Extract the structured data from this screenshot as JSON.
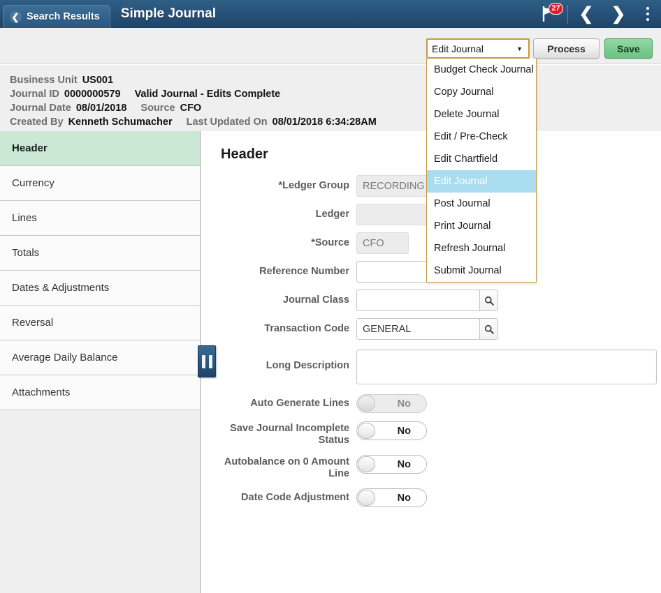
{
  "topbar": {
    "back_label": "Search Results",
    "back_icon": "chevron-left-icon",
    "title": "Simple Journal",
    "flag_icon": "flag-icon",
    "flag_badge_count": "27",
    "prev_icon": "chevron-left-icon",
    "next_icon": "chevron-right-icon",
    "kebab_icon": "vertical-ellipsis-icon",
    "bg_color": "#27527a"
  },
  "actionbar": {
    "process_select": {
      "value": "Edit Journal",
      "caret_icon": "chevron-down-icon",
      "border_color": "#c79a3a",
      "highlight_color": "#aadcf0",
      "options": [
        "Budget Check Journal",
        "Copy Journal",
        "Delete Journal",
        "Edit / Pre-Check",
        "Edit Chartfield",
        "Edit Journal",
        "Post Journal",
        "Print Journal",
        "Refresh Journal",
        "Submit Journal"
      ],
      "selected_index": 5
    },
    "process_button": "Process",
    "save_button": "Save",
    "save_color": "#7dcd92"
  },
  "journal_info": {
    "rows": [
      [
        {
          "label": "Business Unit",
          "value": "US001"
        }
      ],
      [
        {
          "label": "Journal ID",
          "value": "0000000579"
        },
        {
          "label": "",
          "value": "Valid Journal - Edits Complete"
        }
      ],
      [
        {
          "label": "Journal Date",
          "value": "08/01/2018"
        },
        {
          "label": "Source",
          "value": "CFO"
        }
      ],
      [
        {
          "label": "Created By",
          "value": "Kenneth Schumacher"
        },
        {
          "label": "Last Updated On",
          "value": "08/01/2018  6:34:28AM"
        }
      ]
    ],
    "business_unit_label": "Business Unit",
    "business_unit_value": "US001",
    "journal_id_label": "Journal ID",
    "journal_id_value": "0000000579",
    "journal_status": "Valid Journal - Edits Complete",
    "journal_date_label": "Journal Date",
    "journal_date_value": "08/01/2018",
    "source_label": "Source",
    "source_value": "CFO",
    "created_by_label": "Created By",
    "created_by_value": "Kenneth Schumacher",
    "last_updated_label": "Last Updated On",
    "last_updated_value": "08/01/2018  6:34:28AM"
  },
  "sidebar": {
    "items": [
      {
        "label": "Header",
        "active": true
      },
      {
        "label": "Currency",
        "active": false
      },
      {
        "label": "Lines",
        "active": false
      },
      {
        "label": "Totals",
        "active": false
      },
      {
        "label": "Dates & Adjustments",
        "active": false
      },
      {
        "label": "Reversal",
        "active": false
      },
      {
        "label": "Average Daily Balance",
        "active": false
      },
      {
        "label": "Attachments",
        "active": false
      }
    ],
    "active_color": "#cbe8d5",
    "collapse_handle_icon": "pause-bars-icon"
  },
  "content": {
    "title": "Header",
    "fields": {
      "ledger_group_label": "*Ledger Group",
      "ledger_group_value": "RECORDING",
      "ledger_label": "Ledger",
      "ledger_value": "",
      "source_label": "*Source",
      "source_value": "CFO",
      "reference_number_label": "Reference Number",
      "reference_number_value": "",
      "journal_class_label": "Journal Class",
      "journal_class_value": "",
      "transaction_code_label": "Transaction Code",
      "transaction_code_value": "GENERAL",
      "long_description_label": "Long Description",
      "long_description_value": "",
      "lookup_icon": "search-icon"
    },
    "toggles": [
      {
        "label": "Auto Generate Lines",
        "value": "No",
        "disabled": true
      },
      {
        "label": "Save Journal Incomplete Status",
        "value": "No",
        "disabled": false
      },
      {
        "label": "Autobalance on 0 Amount Line",
        "value": "No",
        "disabled": false
      },
      {
        "label": "Date Code Adjustment",
        "value": "No",
        "disabled": false
      }
    ]
  }
}
